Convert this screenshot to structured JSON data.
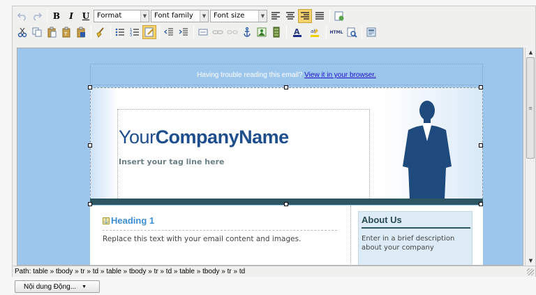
{
  "toolbar": {
    "format": "Format",
    "font_family": "Font family",
    "font_size": "Font size",
    "bold": "B",
    "italic": "I",
    "underline": "U",
    "html_label": "HTML"
  },
  "email": {
    "trouble_text": "Having trouble reading this email?",
    "trouble_link": "View it in your browser.",
    "company_regular": "Your",
    "company_bold": "CompanyName",
    "tagline": "Insert your tag line here",
    "heading": "Heading 1",
    "body_text": "Replace this text with your email content and images.",
    "about_title": "About Us",
    "about_text": "Enter in a brief description about your company"
  },
  "status": {
    "path": "Path: table » tbody » tr » td » table » tbody » tr » td » table » tbody » tr » td"
  },
  "dynamic_button": "Nội dung Động...",
  "colors": {
    "editor_bg": "#9dc6ec",
    "brand_blue": "#1f4e8c",
    "bar_teal": "#2e5662",
    "heading_blue": "#3b8fd4"
  }
}
